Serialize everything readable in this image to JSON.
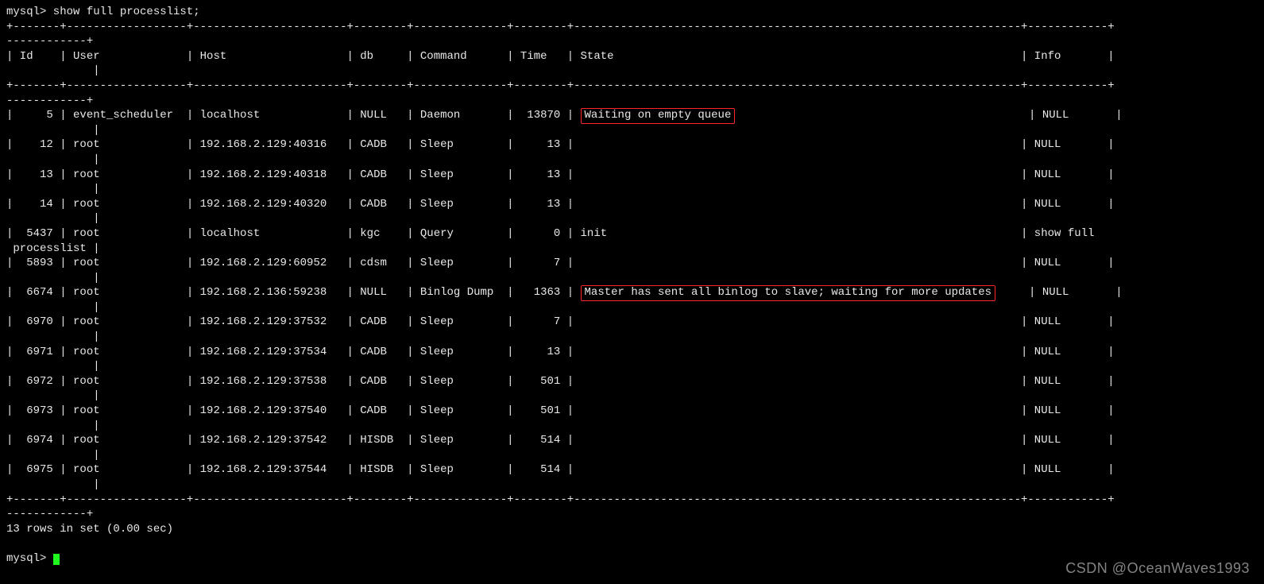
{
  "prompt": "mysql>",
  "command": "show full processlist;",
  "columns": {
    "id": {
      "header": "Id",
      "width": 5,
      "align": "right"
    },
    "user": {
      "header": "User",
      "width": 16,
      "align": "left"
    },
    "host": {
      "header": "Host",
      "width": 21,
      "align": "left"
    },
    "db": {
      "header": "db",
      "width": 6,
      "align": "left"
    },
    "command": {
      "header": "Command",
      "width": 12,
      "align": "left"
    },
    "time": {
      "header": "Time",
      "width": 6,
      "align": "right"
    },
    "state": {
      "header": "State",
      "width": 65,
      "align": "left"
    },
    "info": {
      "header": "Info",
      "width": 10,
      "align": "left"
    }
  },
  "rows": [
    {
      "id": "5",
      "user": "event_scheduler",
      "host": "localhost",
      "db": "NULL",
      "command": "Daemon",
      "time": "13870",
      "state": "Waiting on empty queue",
      "state_hl": true,
      "info": "NULL"
    },
    {
      "id": "12",
      "user": "root",
      "host": "192.168.2.129:40316",
      "db": "CADB",
      "command": "Sleep",
      "time": "13",
      "state": "",
      "info": "NULL"
    },
    {
      "id": "13",
      "user": "root",
      "host": "192.168.2.129:40318",
      "db": "CADB",
      "command": "Sleep",
      "time": "13",
      "state": "",
      "info": "NULL"
    },
    {
      "id": "14",
      "user": "root",
      "host": "192.168.2.129:40320",
      "db": "CADB",
      "command": "Sleep",
      "time": "13",
      "state": "",
      "info": "NULL"
    },
    {
      "id": "5437",
      "user": "root",
      "host": "localhost",
      "db": "kgc",
      "command": "Query",
      "time": "0",
      "state": "init",
      "info": "show full processlist",
      "info_wrap": true
    },
    {
      "id": "5893",
      "user": "root",
      "host": "192.168.2.129:60952",
      "db": "cdsm",
      "command": "Sleep",
      "time": "7",
      "state": "",
      "info": "NULL"
    },
    {
      "id": "6674",
      "user": "root",
      "host": "192.168.2.136:59238",
      "db": "NULL",
      "command": "Binlog Dump",
      "time": "1363",
      "state": "Master has sent all binlog to slave; waiting for more updates",
      "state_hl": true,
      "info": "NULL"
    },
    {
      "id": "6970",
      "user": "root",
      "host": "192.168.2.129:37532",
      "db": "CADB",
      "command": "Sleep",
      "time": "7",
      "state": "",
      "info": "NULL"
    },
    {
      "id": "6971",
      "user": "root",
      "host": "192.168.2.129:37534",
      "db": "CADB",
      "command": "Sleep",
      "time": "13",
      "state": "",
      "info": "NULL"
    },
    {
      "id": "6972",
      "user": "root",
      "host": "192.168.2.129:37538",
      "db": "CADB",
      "command": "Sleep",
      "time": "501",
      "state": "",
      "info": "NULL"
    },
    {
      "id": "6973",
      "user": "root",
      "host": "192.168.2.129:37540",
      "db": "CADB",
      "command": "Sleep",
      "time": "501",
      "state": "",
      "info": "NULL"
    },
    {
      "id": "6974",
      "user": "root",
      "host": "192.168.2.129:37542",
      "db": "HISDB",
      "command": "Sleep",
      "time": "514",
      "state": "",
      "info": "NULL"
    },
    {
      "id": "6975",
      "user": "root",
      "host": "192.168.2.129:37544",
      "db": "HISDB",
      "command": "Sleep",
      "time": "514",
      "state": "",
      "info": "NULL"
    }
  ],
  "footer": "13 rows in set (0.00 sec)",
  "watermark": "CSDN @OceanWaves1993",
  "ending_prompt": "mysql>"
}
